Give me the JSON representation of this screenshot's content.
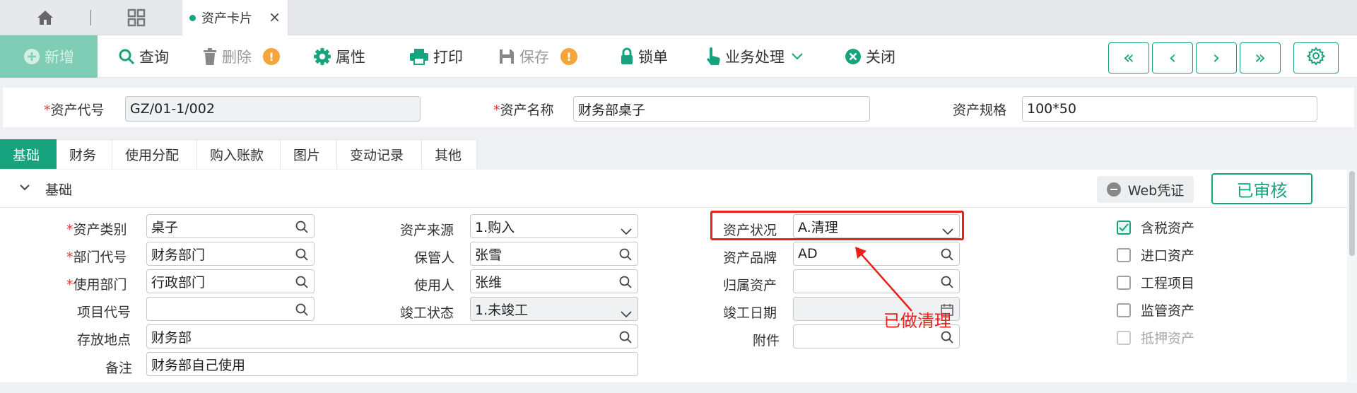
{
  "tab": {
    "title": "资产卡片"
  },
  "toolbar": {
    "new": "新增",
    "query": "查询",
    "delete": "删除",
    "attribute": "属性",
    "print": "打印",
    "save": "保存",
    "lock": "锁单",
    "business": "业务处理",
    "close": "关闭"
  },
  "header": {
    "asset_code_label": "资产代号",
    "asset_code": "GZ/01-1/002",
    "asset_name_label": "资产名称",
    "asset_name": "财务部桌子",
    "spec_label": "资产规格",
    "spec": "100*50"
  },
  "section_tabs": [
    "基础",
    "财务",
    "使用分配",
    "购入账款",
    "图片",
    "变动记录",
    "其他"
  ],
  "section": {
    "title": "基础",
    "web_voucher": "Web凭证",
    "audited": "已审核"
  },
  "form": {
    "category_label": "资产类别",
    "category": "桌子",
    "dept_code_label": "部门代号",
    "dept_code": "财务部门",
    "use_dept_label": "使用部门",
    "use_dept": "行政部门",
    "project_code_label": "项目代号",
    "project_code": "",
    "location_label": "存放地点",
    "location": "财务部",
    "remark_label": "备注",
    "remark": "财务部自己使用",
    "source_label": "资产来源",
    "source": "1.购入",
    "keeper_label": "保管人",
    "keeper": "张雪",
    "user_label": "使用人",
    "user": "张维",
    "completion_label": "竣工状态",
    "completion": "1.未竣工",
    "status_label": "资产状况",
    "status": "A.清理",
    "brand_label": "资产品牌",
    "brand": "AD",
    "parent_label": "归属资产",
    "parent": "",
    "complete_date_label": "竣工日期",
    "complete_date": "",
    "attachment_label": "附件",
    "attachment": ""
  },
  "checks": [
    {
      "label": "含税资产",
      "checked": true
    },
    {
      "label": "进口资产",
      "checked": false
    },
    {
      "label": "工程项目",
      "checked": false
    },
    {
      "label": "监管资产",
      "checked": false
    },
    {
      "label": "抵押资产",
      "checked": false
    }
  ],
  "annotation": "已做清理",
  "colors": {
    "accent": "#16a37e",
    "annotation": "#e8211a",
    "warning": "#f4a43b"
  }
}
